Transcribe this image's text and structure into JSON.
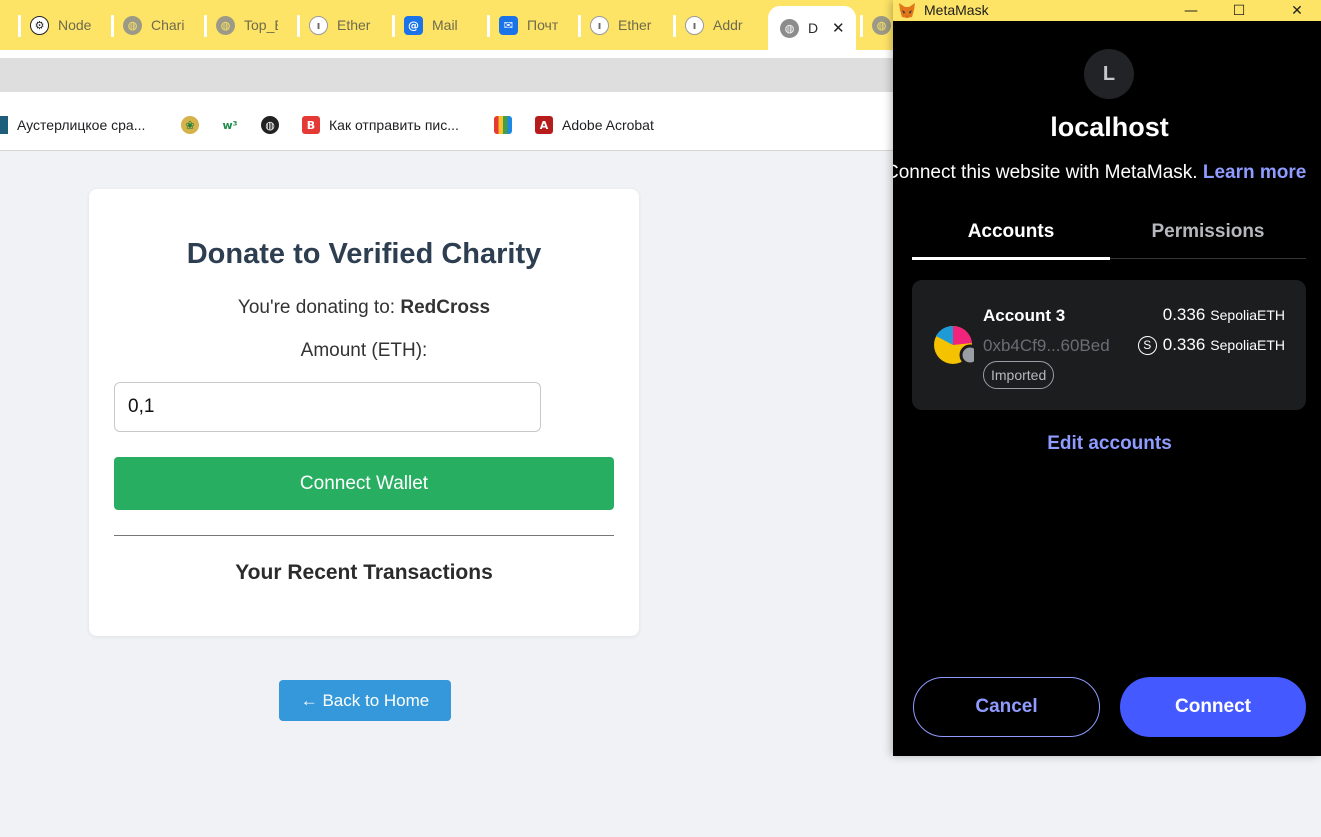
{
  "browser": {
    "tabs": [
      {
        "title": "Node",
        "icon": "openai-icon"
      },
      {
        "title": "Chari",
        "icon": "globe-icon"
      },
      {
        "title": "Top_E",
        "icon": "globe-icon"
      },
      {
        "title": "Ether",
        "icon": "etherscan-icon"
      },
      {
        "title": "Mail",
        "icon": "mail-at-icon"
      },
      {
        "title": "Почт",
        "icon": "mail-envelope-icon"
      },
      {
        "title": "Ether",
        "icon": "etherscan-icon"
      },
      {
        "title": "Addr",
        "icon": "etherscan-icon"
      },
      {
        "title": "D",
        "icon": "globe-icon",
        "active": true
      }
    ],
    "close_glyph": "✕",
    "bookmarks": [
      {
        "label": "Аустерлицкое сра...",
        "icon": "bookmark-flag-icon"
      },
      {
        "label": "",
        "icon": "coin-icon"
      },
      {
        "label": "",
        "icon": "w3-icon"
      },
      {
        "label": "",
        "icon": "globe-icon"
      },
      {
        "label": "Как отправить пис...",
        "icon": "red-b-icon"
      },
      {
        "label": "",
        "icon": "books-icon"
      },
      {
        "label": "Adobe Acrobat",
        "icon": "acrobat-icon"
      }
    ],
    "colors": {
      "tabstrip": "#fde467",
      "bookmarks_bg": "#ffffff"
    }
  },
  "page": {
    "title": "Donate to Verified Charity",
    "donating_prefix": "You're donating to: ",
    "charity_name": "RedCross",
    "amount_label": "Amount (ETH):",
    "amount_value": "0,1",
    "connect_wallet_label": "Connect Wallet",
    "recent_transactions_heading": "Your Recent Transactions",
    "back_home_label": "← Back to Home",
    "colors": {
      "connect_button": "#27ae60",
      "back_button": "#3498db",
      "heading": "#2d3e50"
    }
  },
  "metamask": {
    "window_title": "MetaMask",
    "window_controls": {
      "minimize": "—",
      "maximize": "☐",
      "close": "✕"
    },
    "site_initial": "L",
    "site_host": "localhost",
    "subtitle": "Connect this website with MetaMask. ",
    "learn_more": "Learn more",
    "tabs": {
      "accounts": "Accounts",
      "permissions": "Permissions"
    },
    "account": {
      "name": "Account 3",
      "address": "0xb4Cf9...60Bed",
      "badge": "Imported",
      "balance_1": "0.336",
      "unit_1": "SepoliaETH",
      "network_letter": "S",
      "balance_2": "0.336",
      "unit_2": "SepoliaETH"
    },
    "edit_accounts": "Edit accounts",
    "cancel_label": "Cancel",
    "connect_label": "Connect",
    "colors": {
      "accent": "#8f9bff",
      "primary": "#4459ff",
      "background": "#000000",
      "card": "#1c1d1f"
    }
  }
}
